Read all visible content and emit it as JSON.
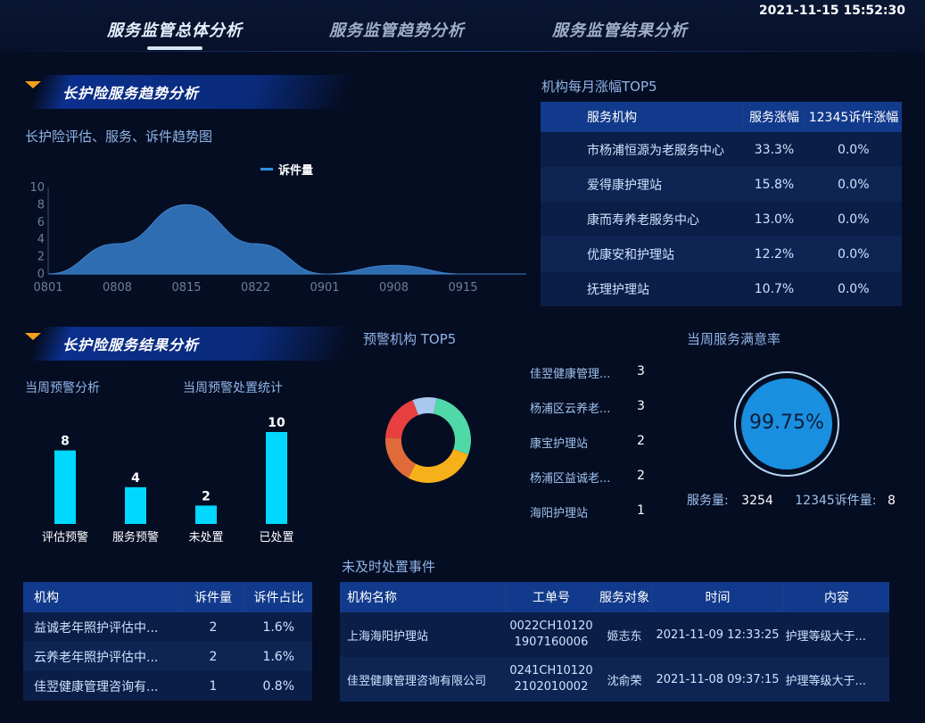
{
  "header": {
    "datetime": "2021-11-15 15:52:30",
    "tabs": [
      {
        "label": "服务监管总体分析",
        "active": true
      },
      {
        "label": "服务监管趋势分析",
        "active": false
      },
      {
        "label": "服务监管结果分析",
        "active": false
      }
    ]
  },
  "trend_section": {
    "title": "长护险服务趋势分析",
    "chart_title": "长护险评估、服务、诉件趋势图"
  },
  "chart_data": {
    "type": "area",
    "series": [
      {
        "name": "诉件量",
        "values": [
          0,
          3.5,
          8,
          3.5,
          0,
          1,
          0,
          0
        ]
      }
    ],
    "x": [
      "0801",
      "0808",
      "0815",
      "0822",
      "0901",
      "0908",
      "0915",
      ""
    ],
    "ylim": [
      0,
      10
    ],
    "yticks": [
      "0",
      "2",
      "4",
      "6",
      "8",
      "10"
    ],
    "color": "#2f6db3"
  },
  "top5_table": {
    "title": "机构每月涨幅TOP5",
    "headers": [
      "服务机构",
      "服务涨幅",
      "12345诉件涨幅"
    ],
    "rows": [
      [
        "市杨浦恒源为老服务中心",
        "33.3%",
        "0.0%"
      ],
      [
        "爱得康护理站",
        "15.8%",
        "0.0%"
      ],
      [
        "康而寿养老服务中心",
        "13.0%",
        "0.0%"
      ],
      [
        "优康安和护理站",
        "12.2%",
        "0.0%"
      ],
      [
        "抚理护理站",
        "10.7%",
        "0.0%"
      ]
    ]
  },
  "result_section": {
    "title": "长护险服务结果分析",
    "warn_label": "当周预警分析",
    "handle_label": "当周预警处置统计",
    "bars": [
      {
        "label": "评估预警",
        "value": 8
      },
      {
        "label": "服务预警",
        "value": 4
      },
      {
        "label": "未处置",
        "value": 2
      },
      {
        "label": "已处置",
        "value": 10
      }
    ],
    "bar_max": 10,
    "bar_color": "#00d8ff"
  },
  "warn_top5": {
    "title": "预警机构 TOP5",
    "items": [
      {
        "name": "佳翌健康管理...",
        "value": 3,
        "color": "#4fd9a8"
      },
      {
        "name": "杨浦区云养老...",
        "value": 3,
        "color": "#f6b01a"
      },
      {
        "name": "康宝护理站",
        "value": 2,
        "color": "#e06a3a"
      },
      {
        "name": "杨浦区益诚老...",
        "value": 2,
        "color": "#e84040"
      },
      {
        "name": "海阳护理站",
        "value": 1,
        "color": "#a9c8f0"
      }
    ]
  },
  "satisfaction": {
    "title": "当周服务满意率",
    "rate": "99.75%",
    "service_label": "服务量:",
    "service_value": "3254",
    "complaint_label": "12345诉件量:",
    "complaint_value": "8",
    "ball_color": "#1a8fe0"
  },
  "org_table": {
    "headers": [
      "机构",
      "诉件量",
      "诉件占比"
    ],
    "rows": [
      [
        "益诚老年照护评估中...",
        "2",
        "1.6%"
      ],
      [
        "云养老年照护评估中...",
        "2",
        "1.6%"
      ],
      [
        "佳翌健康管理咨询有...",
        "1",
        "0.8%"
      ]
    ]
  },
  "events": {
    "title": "未及时处置事件",
    "headers": [
      "机构名称",
      "工单号",
      "服务对象",
      "时间",
      "内容"
    ],
    "rows": [
      {
        "org": "上海海阳护理站",
        "ticket_line1": "0022CH10120",
        "ticket_line2": "1907160006",
        "person": "姬志东",
        "time": "2021-11-09 12:33:25",
        "content": "护理等级大于..."
      },
      {
        "org": "佳翌健康管理咨询有限公司",
        "ticket_line1": "0241CH10120",
        "ticket_line2": "2102010002",
        "person": "沈俞荣",
        "time": "2021-11-08 09:37:15",
        "content": "护理等级大于..."
      }
    ]
  }
}
